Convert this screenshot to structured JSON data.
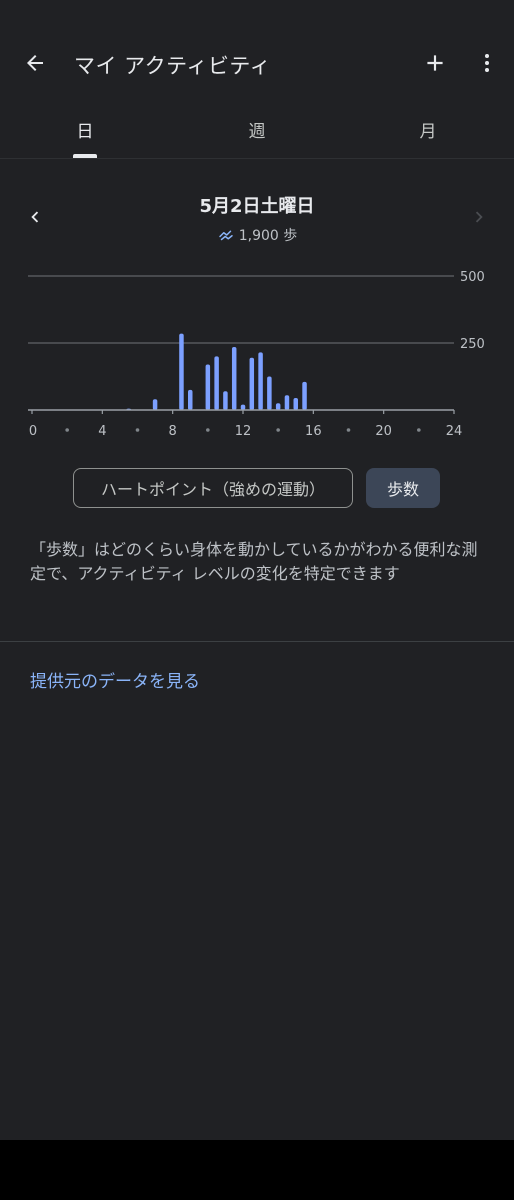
{
  "app_bar": {
    "title": "マイ アクティビティ",
    "back_icon": "arrow-back-icon",
    "add_icon": "add-icon",
    "more_icon": "more-vert-icon"
  },
  "tabs": [
    {
      "label": "日",
      "selected": true
    },
    {
      "label": "週",
      "selected": false
    },
    {
      "label": "月",
      "selected": false
    }
  ],
  "date_nav": {
    "date": "5月2日土曜日",
    "steps_text": "1,900 歩",
    "prev_icon": "chevron-left-icon",
    "next_icon": "chevron-right-icon",
    "next_enabled": false,
    "steps_icon": "footsteps-icon"
  },
  "chart_data": {
    "type": "bar",
    "x": [
      5.5,
      7,
      8.5,
      9,
      10,
      10.5,
      11,
      11.5,
      12,
      12.5,
      13,
      13.5,
      14,
      14.5,
      15,
      15.5
    ],
    "values": [
      5,
      40,
      285,
      75,
      170,
      200,
      70,
      235,
      20,
      195,
      215,
      125,
      25,
      55,
      45,
      105
    ],
    "xlim": [
      0,
      24
    ],
    "ylim": [
      0,
      500
    ],
    "x_ticks": [
      "0",
      "4",
      "8",
      "12",
      "16",
      "20",
      "24"
    ],
    "y_ticks": [
      "250",
      "500"
    ],
    "grid": true,
    "bar_color": "#7ca0ff"
  },
  "chips": {
    "heart": "ハートポイント（強めの運動）",
    "steps": "歩数",
    "selected": "steps"
  },
  "description": "「歩数」はどのくらい身体を動かしているかがわかる便利な測定で、アクティビティ レベルの変化を特定できます",
  "source_link": "提供元のデータを見る",
  "colors": {
    "background": "#202124",
    "accent": "#8ab4f8",
    "chip_selected": "#3c4657"
  }
}
